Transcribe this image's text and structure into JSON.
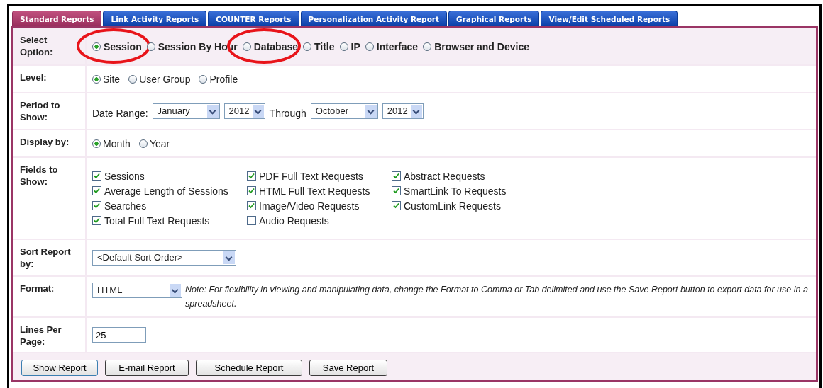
{
  "tabs": [
    {
      "label": "Standard Reports",
      "selected": true
    },
    {
      "label": "Link Activity Reports",
      "selected": false
    },
    {
      "label": "COUNTER Reports",
      "selected": false
    },
    {
      "label": "Personalization Activity Report",
      "selected": false
    },
    {
      "label": "Graphical Reports",
      "selected": false
    },
    {
      "label": "View/Edit Scheduled Reports",
      "selected": false
    }
  ],
  "rows": [
    {
      "kind": "radio",
      "label": "Select Option:",
      "emphasis": true,
      "options": [
        {
          "label": "Session",
          "selected": true,
          "circled": true
        },
        {
          "label": "Session By Hour",
          "selected": false,
          "circled": false
        },
        {
          "label": "Database",
          "selected": false,
          "circled": true
        },
        {
          "label": "Title",
          "selected": false,
          "circled": false
        },
        {
          "label": "IP",
          "selected": false,
          "circled": false
        },
        {
          "label": "Interface",
          "selected": false,
          "circled": false
        },
        {
          "label": "Browser and Device",
          "selected": false,
          "circled": false
        }
      ]
    },
    {
      "kind": "radio",
      "label": "Level:",
      "emphasis": false,
      "options": [
        {
          "label": "Site",
          "selected": true,
          "circled": false
        },
        {
          "label": "User Group",
          "selected": false,
          "circled": false
        },
        {
          "label": "Profile",
          "selected": false,
          "circled": false
        }
      ]
    },
    {
      "kind": "period",
      "label": "Period to Show:",
      "from_label": "Date Range:",
      "from_month": "January",
      "from_year": "2012",
      "through_label": "Through",
      "to_month": "October",
      "to_year": "2012"
    },
    {
      "kind": "radio",
      "label": "Display by:",
      "emphasis": false,
      "options": [
        {
          "label": "Month",
          "selected": true,
          "circled": false
        },
        {
          "label": "Year",
          "selected": false,
          "circled": false
        }
      ]
    },
    {
      "kind": "checkboxes",
      "label": "Fields to Show:",
      "columns": [
        [
          {
            "label": "Sessions",
            "checked": true
          },
          {
            "label": "Average Length of Sessions",
            "checked": true
          },
          {
            "label": "Searches",
            "checked": true
          },
          {
            "label": "Total Full Text Requests",
            "checked": true
          }
        ],
        [
          {
            "label": "PDF Full Text Requests",
            "checked": true
          },
          {
            "label": "HTML Full Text Requests",
            "checked": true
          },
          {
            "label": "Image/Video Requests",
            "checked": true
          },
          {
            "label": "Audio Requests",
            "checked": false
          }
        ],
        [
          {
            "label": "Abstract Requests",
            "checked": true
          },
          {
            "label": "SmartLink To Requests",
            "checked": true
          },
          {
            "label": "CustomLink Requests",
            "checked": true
          }
        ]
      ]
    },
    {
      "kind": "select",
      "label": "Sort Report by:",
      "value": "<Default Sort Order>"
    },
    {
      "kind": "format",
      "label": "Format:",
      "value": "HTML",
      "note": "Note: For flexibility in viewing and manipulating data, change the Format to Comma or Tab delimited and use the Save Report button to export data for use in a spreadsheet."
    },
    {
      "kind": "text",
      "label": "Lines Per Page:",
      "value": "25"
    }
  ],
  "buttons": [
    "Show Report",
    "E-mail Report",
    "Schedule Report",
    "Save Report"
  ]
}
